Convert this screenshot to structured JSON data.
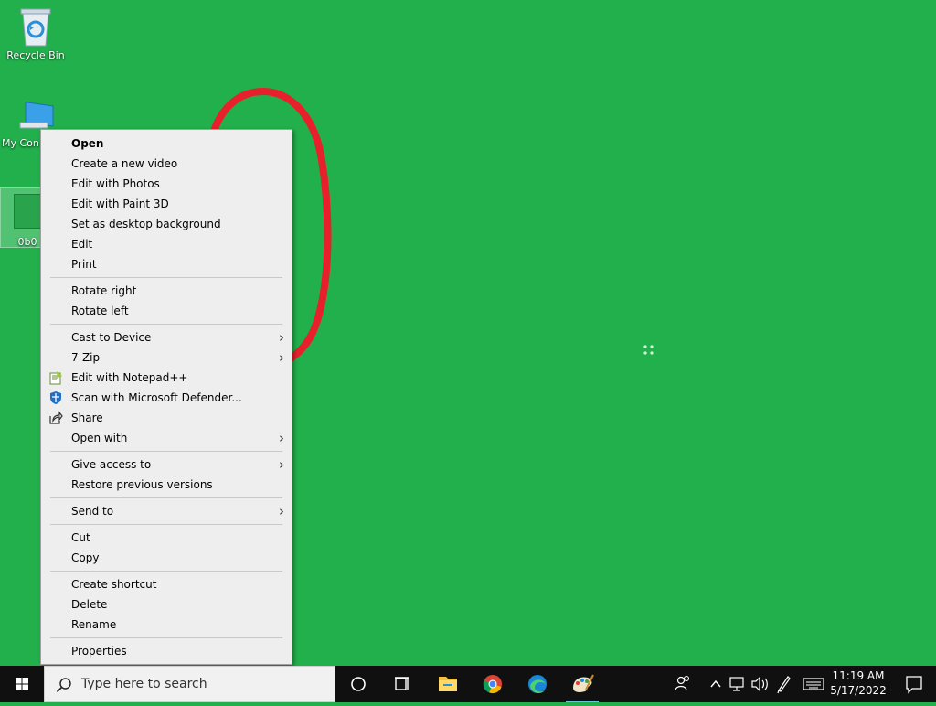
{
  "desktop": {
    "background_color": "#21b04b",
    "icons": [
      {
        "label": "Recycle Bin",
        "icon": "recycle-bin-icon"
      },
      {
        "label": "My Con",
        "icon": "computer-icon"
      },
      {
        "label": "0b0",
        "icon": "image-file-icon",
        "selected": true
      }
    ]
  },
  "context_menu": {
    "items": [
      {
        "label": "Open",
        "bold": true
      },
      {
        "label": "Create a new video"
      },
      {
        "label": "Edit with Photos"
      },
      {
        "label": "Edit with Paint 3D"
      },
      {
        "label": "Set as desktop background"
      },
      {
        "label": "Edit"
      },
      {
        "label": "Print"
      },
      {
        "label": "Rotate right"
      },
      {
        "label": "Rotate left"
      },
      {
        "label": "Cast to Device",
        "submenu": true
      },
      {
        "label": "7-Zip",
        "submenu": true
      },
      {
        "label": "Edit with Notepad++",
        "icon": "notepad-plus-plus-icon"
      },
      {
        "label": "Scan with Microsoft Defender...",
        "icon": "defender-shield-icon"
      },
      {
        "label": "Share",
        "icon": "share-icon"
      },
      {
        "label": "Open with",
        "submenu": true
      },
      {
        "label": "Give access to",
        "submenu": true
      },
      {
        "label": "Restore previous versions"
      },
      {
        "label": "Send to",
        "submenu": true
      },
      {
        "label": "Cut"
      },
      {
        "label": "Copy"
      },
      {
        "label": "Create shortcut"
      },
      {
        "label": "Delete"
      },
      {
        "label": "Rename"
      },
      {
        "label": "Properties"
      }
    ],
    "submenu_glyph": "›"
  },
  "taskbar": {
    "search_placeholder": "Type here to search",
    "pinned": [
      {
        "name": "cortana-icon"
      },
      {
        "name": "task-view-icon"
      },
      {
        "name": "file-explorer-icon"
      },
      {
        "name": "chrome-icon"
      },
      {
        "name": "edge-icon"
      },
      {
        "name": "paint-icon",
        "active": true
      }
    ],
    "tray_icons": [
      "people-icon",
      "chevron-up-icon",
      "network-icon",
      "volume-icon",
      "pen-icon",
      "keyboard-icon"
    ],
    "clock": {
      "time": "11:19 AM",
      "date": "5/17/2022"
    },
    "accent_color": "#76b9ed"
  }
}
